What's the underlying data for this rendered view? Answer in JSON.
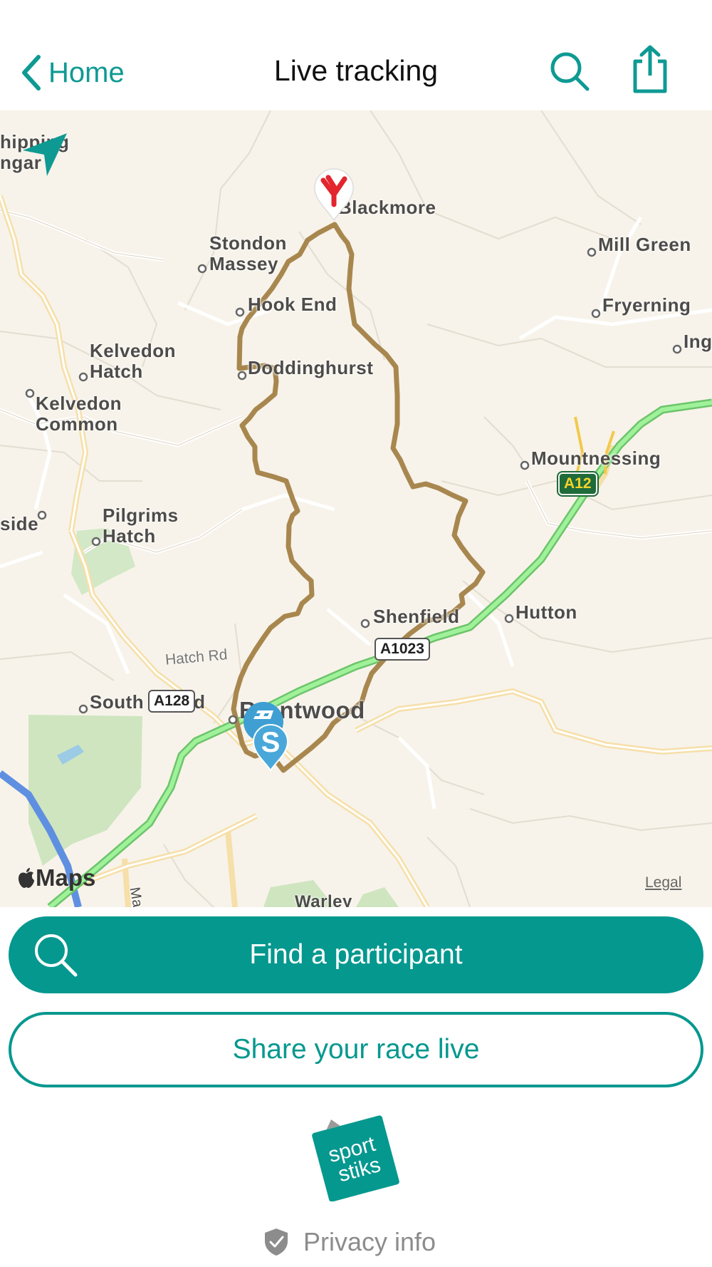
{
  "header": {
    "back_label": "Home",
    "title": "Live tracking"
  },
  "map": {
    "places": {
      "chipping_ongar": "hipping\nngar",
      "blackmore": "Blackmore",
      "stondon_massey": "Stondon\nMassey",
      "mill_green": "Mill Green",
      "hook_end": "Hook End",
      "fryerning": "Fryerning",
      "ing": "Ing",
      "kelvedon_hatch": "Kelvedon\nHatch",
      "doddinghurst": "Doddinghurst",
      "kelvedon_common": "Kelvedon\nCommon",
      "mountnessing": "Mountnessing",
      "side": "side",
      "pilgrims_hatch": "Pilgrims\nHatch",
      "shenfield": "Shenfield",
      "hutton": "Hutton",
      "south_weald": "South Weald",
      "brentwood": "Brentwood",
      "warley": "Warley",
      "ma": "Ma"
    },
    "roads": {
      "a12": "A12",
      "a1023": "A1023",
      "a128": "A128",
      "hatch_rd": "Hatch Rd"
    },
    "attribution": "Maps",
    "legal_label": "Legal"
  },
  "actions": {
    "find_label": "Find a participant",
    "share_label": "Share your race live"
  },
  "footer": {
    "logo_text_1": "sport",
    "logo_text_2": "stiks",
    "privacy_label": "Privacy info"
  },
  "colors": {
    "accent": "#05988f",
    "route": "#a8874f",
    "motorway": "#86df86",
    "finish_red": "#e3252e",
    "start_blue": "#49a8d9"
  }
}
